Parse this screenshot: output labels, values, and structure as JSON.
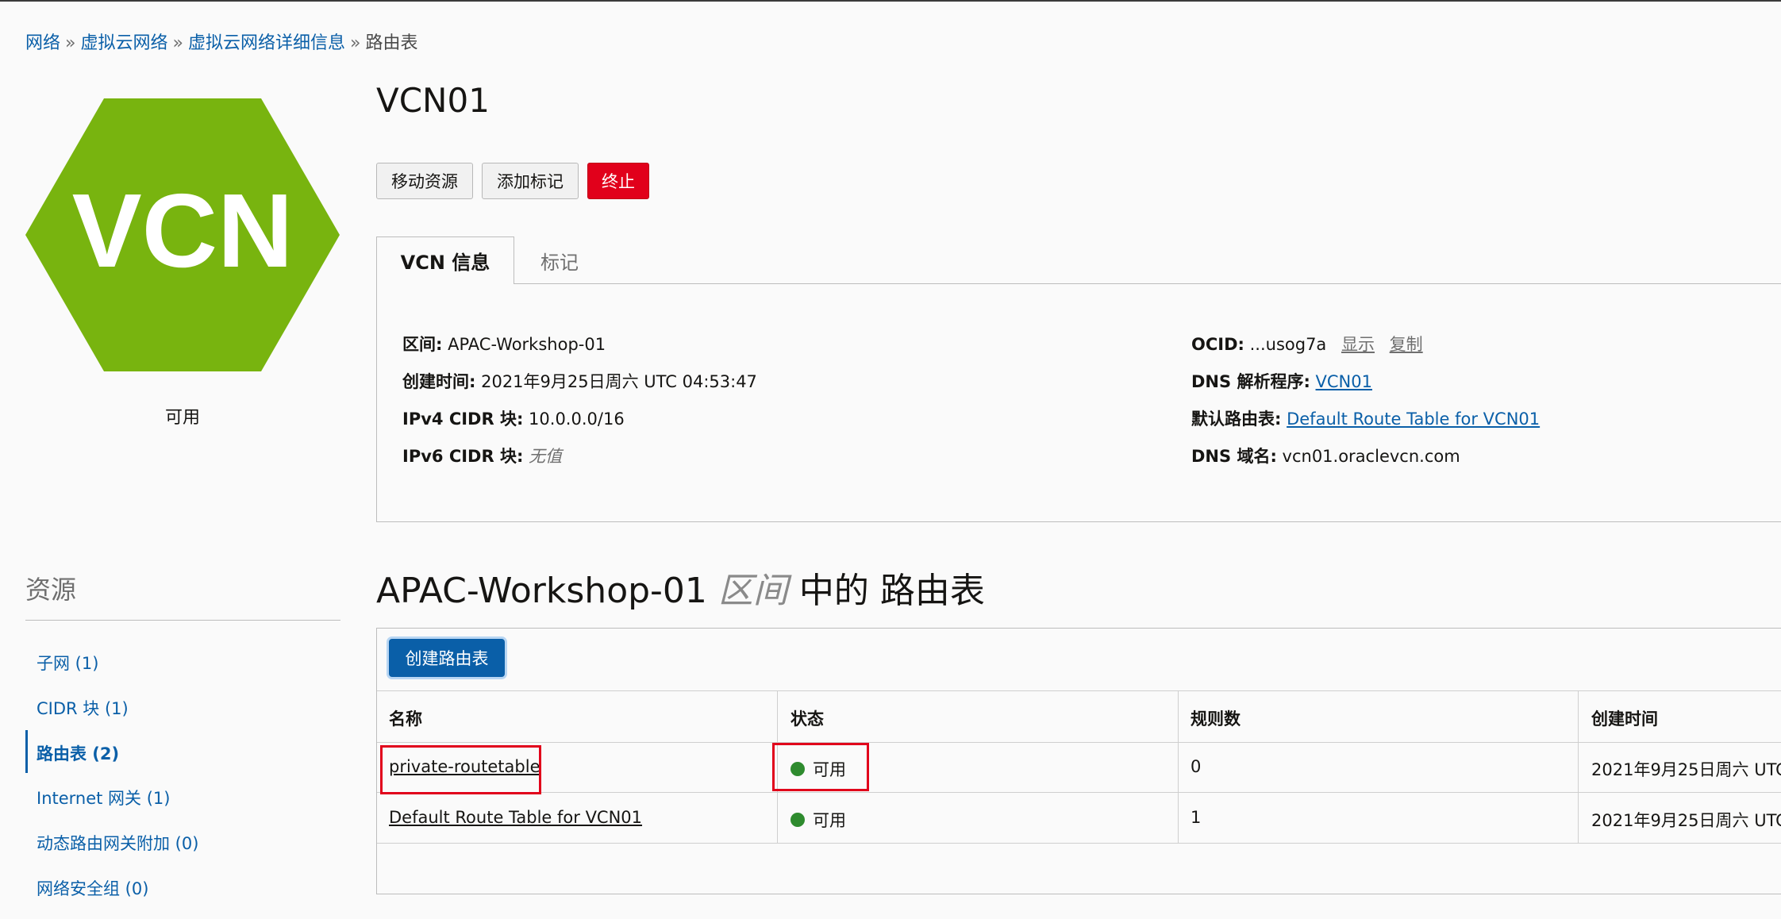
{
  "breadcrumb": {
    "items": [
      "网络",
      "虚拟云网络",
      "虚拟云网络详细信息"
    ],
    "current": "路由表",
    "separator": "»"
  },
  "vcn": {
    "icon_text": "VCN",
    "icon_color": "#78b40f",
    "status": "可用",
    "title": "VCN01"
  },
  "actions": {
    "move_resource": "移动资源",
    "add_tags": "添加标记",
    "terminate": "终止"
  },
  "tabs": {
    "info": "VCN 信息",
    "tags": "标记"
  },
  "details": {
    "compartment_label": "区间:",
    "compartment_value": "APAC-Workshop-01",
    "created_label": "创建时间:",
    "created_value": "2021年9月25日周六 UTC 04:53:47",
    "ipv4_label": "IPv4 CIDR 块:",
    "ipv4_value": "10.0.0.0/16",
    "ipv6_label": "IPv6 CIDR 块:",
    "ipv6_value": "无值",
    "ocid_label": "OCID:",
    "ocid_value": "...usog7a",
    "ocid_show": "显示",
    "ocid_copy": "复制",
    "dns_resolver_label": "DNS 解析程序:",
    "dns_resolver_value": "VCN01",
    "default_route_label": "默认路由表:",
    "default_route_value": "Default Route Table for VCN01",
    "dns_domain_label": "DNS 域名:",
    "dns_domain_value": "vcn01.oraclevcn.com"
  },
  "resources": {
    "heading": "资源",
    "items": [
      {
        "label": "子网 (1)"
      },
      {
        "label": "CIDR 块 (1)"
      },
      {
        "label": "路由表 (2)",
        "active": true
      },
      {
        "label": "Internet 网关 (1)"
      },
      {
        "label": "动态路由网关附加 (0)"
      },
      {
        "label": "网络安全组 (0)"
      }
    ]
  },
  "section": {
    "prefix": "APAC-Workshop-01",
    "italic": "区间",
    "suffix": "中的 路由表"
  },
  "table": {
    "create_button": "创建路由表",
    "columns": [
      "名称",
      "状态",
      "规则数",
      "创建时间"
    ],
    "rows": [
      {
        "name": "private-routetable",
        "status": "可用",
        "rules": "0",
        "created": "2021年9月25日周六 UTC"
      },
      {
        "name": "Default Route Table for VCN01",
        "status": "可用",
        "rules": "1",
        "created": "2021年9月25日周六 UTC"
      }
    ],
    "status_color": "#2e8b2e",
    "highlight_color": "#e1001b"
  }
}
